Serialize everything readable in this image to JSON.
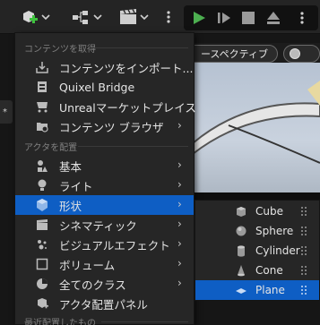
{
  "viewport": {
    "perspective_label": "ースペクティブ"
  },
  "menu": {
    "sections": [
      {
        "header": "コンテンツを取得"
      },
      {
        "header": "アクタを配置"
      },
      {
        "header": "最近配置したもの"
      }
    ],
    "items": [
      {
        "label": "コンテンツをインポート...",
        "icon": "import-icon",
        "has_submenu": false
      },
      {
        "label": "Quixel Bridge",
        "icon": "quixel-bridge-icon",
        "has_submenu": false
      },
      {
        "label": "Unrealマーケットプレイス",
        "icon": "marketplace-icon",
        "has_submenu": false
      },
      {
        "label": "コンテンツ ブラウザ",
        "icon": "content-browser-icon",
        "has_submenu": true
      },
      {
        "label": "基本",
        "icon": "basic-icon",
        "has_submenu": true
      },
      {
        "label": "ライト",
        "icon": "light-icon",
        "has_submenu": true
      },
      {
        "label": "形状",
        "icon": "shapes-icon",
        "has_submenu": true,
        "selected": true
      },
      {
        "label": "シネマティック",
        "icon": "cinematic-icon",
        "has_submenu": true
      },
      {
        "label": "ビジュアルエフェクト",
        "icon": "visual-effects-icon",
        "has_submenu": true
      },
      {
        "label": "ボリューム",
        "icon": "volume-icon",
        "has_submenu": true
      },
      {
        "label": "全てのクラス",
        "icon": "all-classes-icon",
        "has_submenu": true
      },
      {
        "label": "アクタ配置パネル",
        "icon": "place-actors-panel-icon",
        "has_submenu": false
      }
    ]
  },
  "submenu": {
    "items": [
      {
        "label": "Cube",
        "icon": "cube-icon"
      },
      {
        "label": "Sphere",
        "icon": "sphere-icon"
      },
      {
        "label": "Cylinder",
        "icon": "cylinder-icon"
      },
      {
        "label": "Cone",
        "icon": "cone-icon"
      },
      {
        "label": "Plane",
        "icon": "plane-icon",
        "selected": true
      }
    ]
  },
  "colors": {
    "selection": "#0e5ec4",
    "play_green": "#4caf50",
    "add_green": "#3ec23e"
  }
}
